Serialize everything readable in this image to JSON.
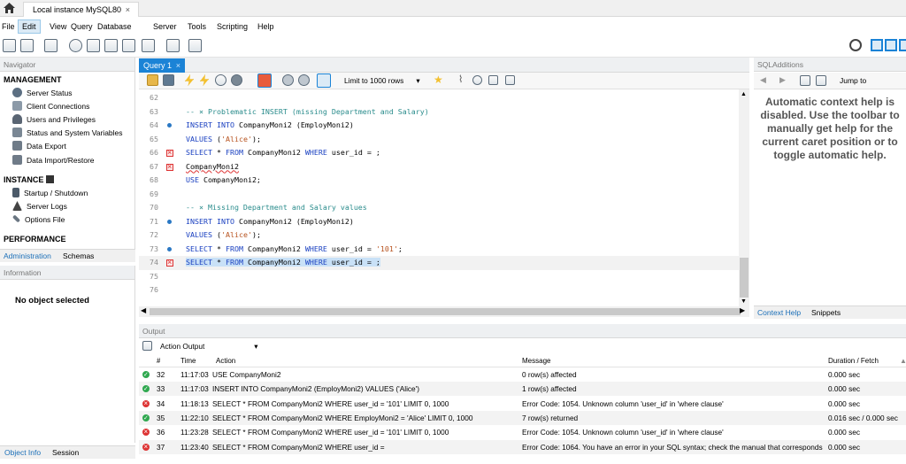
{
  "tabs": {
    "home_icon": "home-icon",
    "connection_tab": "Local instance MySQL80",
    "close": "×"
  },
  "menu": [
    "File",
    "Edit",
    "View",
    "Query",
    "Database",
    "Server",
    "Tools",
    "Scripting",
    "Help"
  ],
  "navigator": {
    "title": "Navigator",
    "management_label": "MANAGEMENT",
    "management_items": [
      "Server Status",
      "Client Connections",
      "Users and Privileges",
      "Status and System Variables",
      "Data Export",
      "Data Import/Restore"
    ],
    "instance_label": "INSTANCE",
    "instance_items": [
      "Startup / Shutdown",
      "Server Logs",
      "Options File"
    ],
    "performance_label": "PERFORMANCE",
    "tabs": [
      "Administration",
      "Schemas"
    ],
    "information_title": "Information",
    "no_object": "No object selected",
    "bottom_tabs": [
      "Object Info",
      "Session"
    ]
  },
  "editor": {
    "tab_label": "Query 1",
    "limit_label": "Limit to 1000 rows",
    "lines": [
      {
        "n": "62",
        "marker": "",
        "text": ""
      },
      {
        "n": "63",
        "marker": "",
        "text": "-- × Problematic INSERT (missing Department and Salary)"
      },
      {
        "n": "64",
        "marker": "dot",
        "text": "INSERT INTO CompanyMoni2 (EmployMoni2)"
      },
      {
        "n": "65",
        "marker": "",
        "text": "VALUES ('Alice');"
      },
      {
        "n": "66",
        "marker": "err",
        "text": "SELECT * FROM CompanyMoni2 WHERE user_id = ;"
      },
      {
        "n": "67",
        "marker": "err",
        "text": "CompanyMoni2"
      },
      {
        "n": "68",
        "marker": "",
        "text": "USE CompanyMoni2;"
      },
      {
        "n": "69",
        "marker": "",
        "text": ""
      },
      {
        "n": "70",
        "marker": "",
        "text": "-- × Missing Department and Salary values"
      },
      {
        "n": "71",
        "marker": "dot",
        "text": "INSERT INTO CompanyMoni2 (EmployMoni2)"
      },
      {
        "n": "72",
        "marker": "",
        "text": "VALUES ('Alice');"
      },
      {
        "n": "73",
        "marker": "dot",
        "text": "SELECT * FROM CompanyMoni2 WHERE user_id = '101';"
      },
      {
        "n": "74",
        "marker": "err",
        "text": "SELECT * FROM CompanyMoni2 WHERE user_id = ;"
      },
      {
        "n": "75",
        "marker": "",
        "text": ""
      },
      {
        "n": "76",
        "marker": "",
        "text": ""
      }
    ]
  },
  "sql_additions": {
    "title": "SQLAdditions",
    "jump_to": "Jump to",
    "help_text": "Automatic context help is disabled. Use the toolbar to manually get help for the current caret position or to toggle automatic help.",
    "tabs": [
      "Context Help",
      "Snippets"
    ]
  },
  "output": {
    "title": "Output",
    "selector": "Action Output",
    "columns": [
      "#",
      "Time",
      "Action",
      "Message",
      "Duration / Fetch"
    ],
    "rows": [
      {
        "status": "ok",
        "num": "32",
        "time": "11:17:03",
        "action": "USE CompanyMoni2",
        "message": "0 row(s) affected",
        "duration": "0.000 sec"
      },
      {
        "status": "ok",
        "num": "33",
        "time": "11:17:03",
        "action": "INSERT INTO CompanyMoni2 (EmployMoni2) VALUES ('Alice')",
        "message": "1 row(s) affected",
        "duration": "0.000 sec"
      },
      {
        "status": "bad",
        "num": "34",
        "time": "11:18:13",
        "action": "SELECT * FROM CompanyMoni2 WHERE user_id = '101' LIMIT 0, 1000",
        "message": "Error Code: 1054. Unknown column 'user_id' in 'where clause'",
        "duration": "0.000 sec"
      },
      {
        "status": "ok",
        "num": "35",
        "time": "11:22:10",
        "action": "SELECT * FROM CompanyMoni2 WHERE EmployMoni2 = 'Alice' LIMIT 0, 1000",
        "message": "7 row(s) returned",
        "duration": "0.016 sec / 0.000 sec"
      },
      {
        "status": "bad",
        "num": "36",
        "time": "11:23:28",
        "action": "SELECT * FROM CompanyMoni2 WHERE user_id = '101' LIMIT 0, 1000",
        "message": "Error Code: 1054. Unknown column 'user_id' in 'where clause'",
        "duration": "0.000 sec"
      },
      {
        "status": "bad",
        "num": "37",
        "time": "11:23:40",
        "action": "SELECT * FROM CompanyMoni2 WHERE user_id =",
        "message": "Error Code: 1064. You have an error in your SQL syntax; check the manual that corresponds ...",
        "duration": "0.000 sec"
      }
    ]
  },
  "colors": {
    "accent": "#1b83d6",
    "error": "#dd3333",
    "ok": "#2fa84f"
  }
}
